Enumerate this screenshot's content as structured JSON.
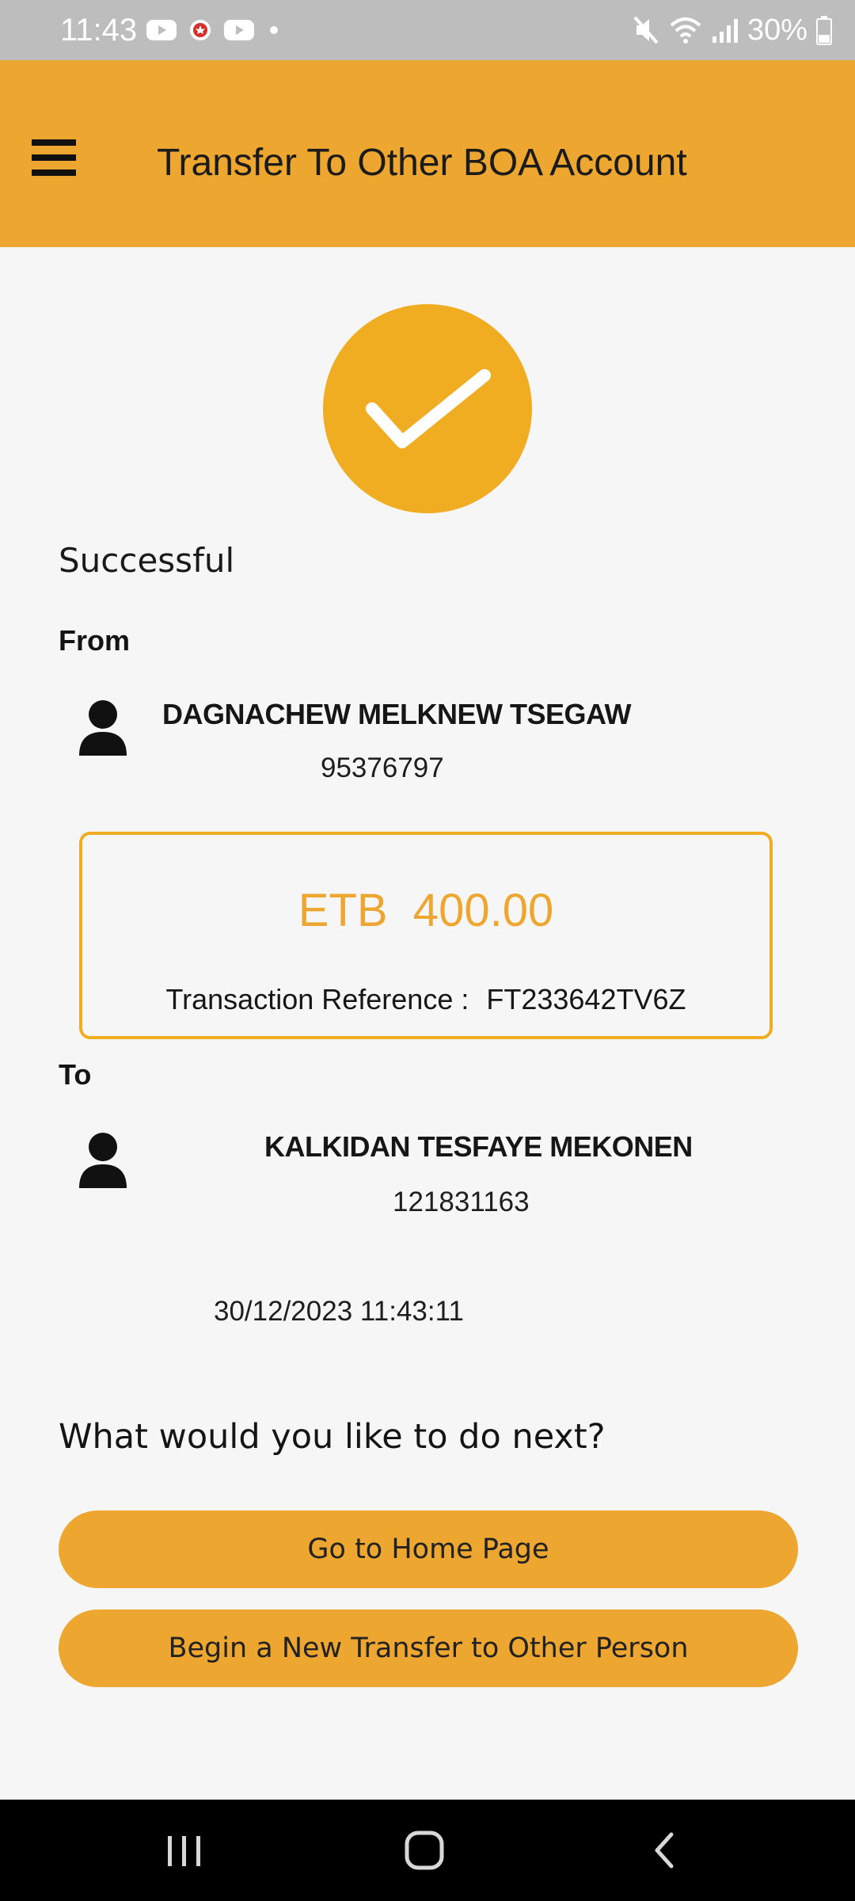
{
  "status_bar": {
    "time": "11:43",
    "battery_percent": "30%",
    "icons_left": [
      "youtube-icon",
      "canada-flag-icon",
      "youtube-icon",
      "dot-icon"
    ],
    "icons_right": [
      "mute-icon",
      "wifi-icon",
      "signal-icon",
      "battery-icon"
    ]
  },
  "app_bar": {
    "title": "Transfer To Other BOA Account",
    "menu_icon": "hamburger-menu-icon",
    "background_color": "#eda630"
  },
  "result": {
    "status_icon": "checkmark-icon",
    "heading": "Successful"
  },
  "from": {
    "label": "From",
    "icon": "person-icon",
    "name": "DAGNACHEW MELKNEW TSEGAW",
    "account_number": "95376797"
  },
  "amount_card": {
    "amount": "ETB  400.00",
    "reference_label": "Transaction Reference :",
    "reference_value": "FT233642TV6Z",
    "accent_color": "#f0ad22"
  },
  "to": {
    "label": "To",
    "icon": "person-icon",
    "name": "KALKIDAN TESFAYE MEKONEN",
    "account_number": "121831163"
  },
  "timestamp": "30/12/2023 11:43:11",
  "next_steps": {
    "heading": "What would you like to do next?",
    "home_button": "Go to Home Page",
    "new_transfer_button": "Begin a New Transfer to Other Person"
  },
  "nav_bar": {
    "icons": [
      "recent-apps-icon",
      "home-icon",
      "back-icon"
    ]
  }
}
